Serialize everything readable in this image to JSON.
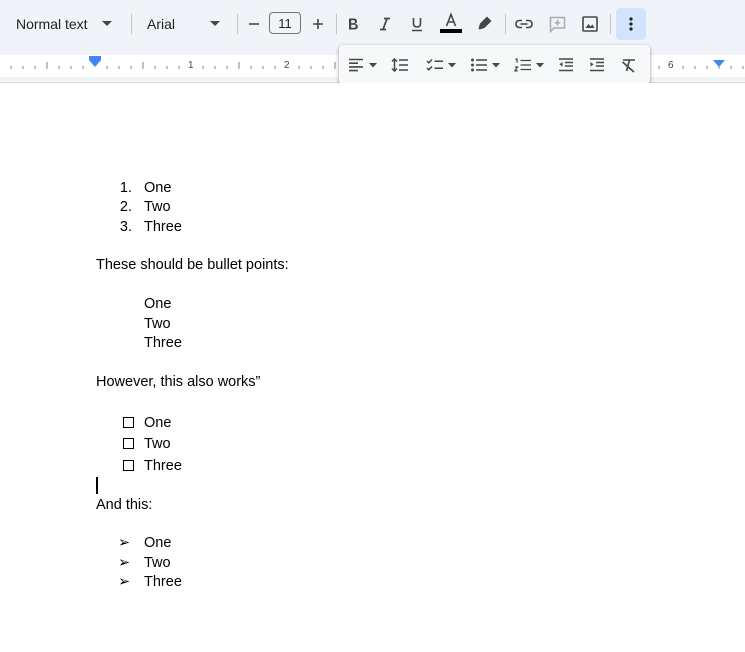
{
  "toolbar": {
    "style_value": "Normal text",
    "font_value": "Arial",
    "font_size": "11"
  },
  "ruler": {
    "numbers": [
      "1",
      "2",
      "6"
    ]
  },
  "document": {
    "numbered_list": [
      {
        "marker": "1.",
        "text": "One"
      },
      {
        "marker": "2.",
        "text": "Two"
      },
      {
        "marker": "3.",
        "text": "Three"
      }
    ],
    "paragraph_bullets": "These should be bullet points:",
    "plain_list": [
      "One",
      "Two",
      "Three"
    ],
    "paragraph_works": "However, this also works”",
    "checklist": [
      "One",
      "Two",
      "Three"
    ],
    "paragraph_and": "And this:",
    "arrow_list": [
      {
        "marker": "➢",
        "text": "One"
      },
      {
        "marker": "➢",
        "text": "Two"
      },
      {
        "marker": "➢",
        "text": "Three"
      }
    ]
  },
  "icons": {
    "toolbar": [
      "chevron-down-icon",
      "minus-icon",
      "plus-icon",
      "bold-icon",
      "italic-icon",
      "underline-icon",
      "text-color-icon",
      "highlighter-icon",
      "link-icon",
      "add-comment-icon",
      "insert-image-icon",
      "more-vert-icon"
    ],
    "popup": [
      "align-left-icon",
      "line-spacing-icon",
      "checklist-icon",
      "bulleted-list-icon",
      "numbered-list-icon",
      "decrease-indent-icon",
      "increase-indent-icon",
      "clear-formatting-icon"
    ]
  },
  "colors": {
    "toolbar_bg": "#f0f4f9",
    "active_button_bg": "#d3e3fd",
    "ruler_marker": "#4285f4",
    "icon": "#444746"
  }
}
